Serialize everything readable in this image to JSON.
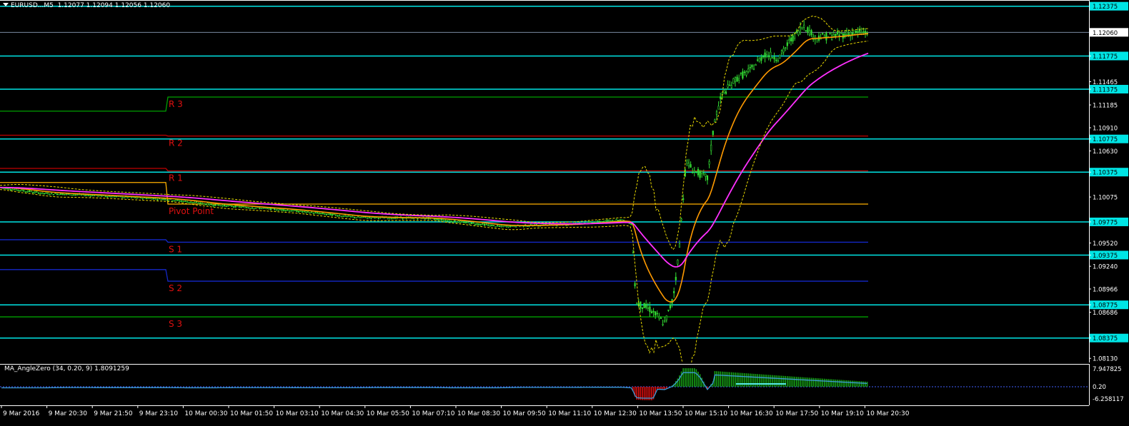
{
  "header": {
    "symbol": "EURUSD...M5",
    "open": "1.12077",
    "high": "1.12094",
    "low": "1.12056",
    "close": "1.12060"
  },
  "indicator": {
    "label": "MA_AngleZero (34, 0.20, 9) 1.8091259",
    "axis_top": "7.947825",
    "axis_bottom": "-6.258117",
    "axis_mid": "0.20"
  },
  "colors": {
    "level_line": "#00e5e5",
    "pivot_r": "#c00000",
    "pivot_r3": "#00a000",
    "pivot_s": "#1428c8",
    "pivot_p": "#ffb000",
    "ma_fast": "#ff9a00",
    "ma_slow": "#ff30ff",
    "bands": "#e8d800",
    "candles": "#33dd33",
    "hist_pos": "#16a016",
    "hist_neg": "#e01010",
    "signal": "#3d9bd6"
  },
  "chart_data": {
    "type": "candlestick",
    "price_axis_labels": [
      "1.12060",
      "1.11775",
      "1.11465",
      "1.11375",
      "1.11185",
      "1.10910",
      "1.10775",
      "1.10630",
      "1.10375",
      "1.10075",
      "1.09775",
      "1.09520",
      "1.09375",
      "1.09240",
      "1.08966",
      "1.08775",
      "1.08686",
      "1.08375",
      "1.08130"
    ],
    "current_price": "1.12060",
    "top_label": "1.12375",
    "time_labels": [
      "9 Mar 2016",
      "9 Mar 20:30",
      "9 Mar 21:50",
      "9 Mar 23:10",
      "10 Mar 00:30",
      "10 Mar 01:50",
      "10 Mar 03:10",
      "10 Mar 04:30",
      "10 Mar 05:50",
      "10 Mar 07:10",
      "10 Mar 08:30",
      "10 Mar 09:50",
      "10 Mar 11:10",
      "10 Mar 12:30",
      "10 Mar 13:50",
      "10 Mar 15:10",
      "10 Mar 16:30",
      "10 Mar 17:50",
      "10 Mar 19:10",
      "10 Mar 20:30"
    ],
    "horizontal_levels": [
      1.12375,
      1.11775,
      1.11375,
      1.10775,
      1.10375,
      1.09775,
      1.09375,
      1.08775,
      1.08375
    ],
    "pivots": [
      {
        "label": "R 3",
        "value": 1.1128
      },
      {
        "label": "R 2",
        "value": 1.1081
      },
      {
        "label": "R 1",
        "value": 1.1039
      },
      {
        "label": "Pivot Point",
        "value": 1.0999
      },
      {
        "label": "S 1",
        "value": 1.0953
      },
      {
        "label": "S 2",
        "value": 1.0906
      },
      {
        "label": "S 3",
        "value": 1.0863
      }
    ],
    "price_range": [
      1.0808,
      1.1245
    ]
  }
}
